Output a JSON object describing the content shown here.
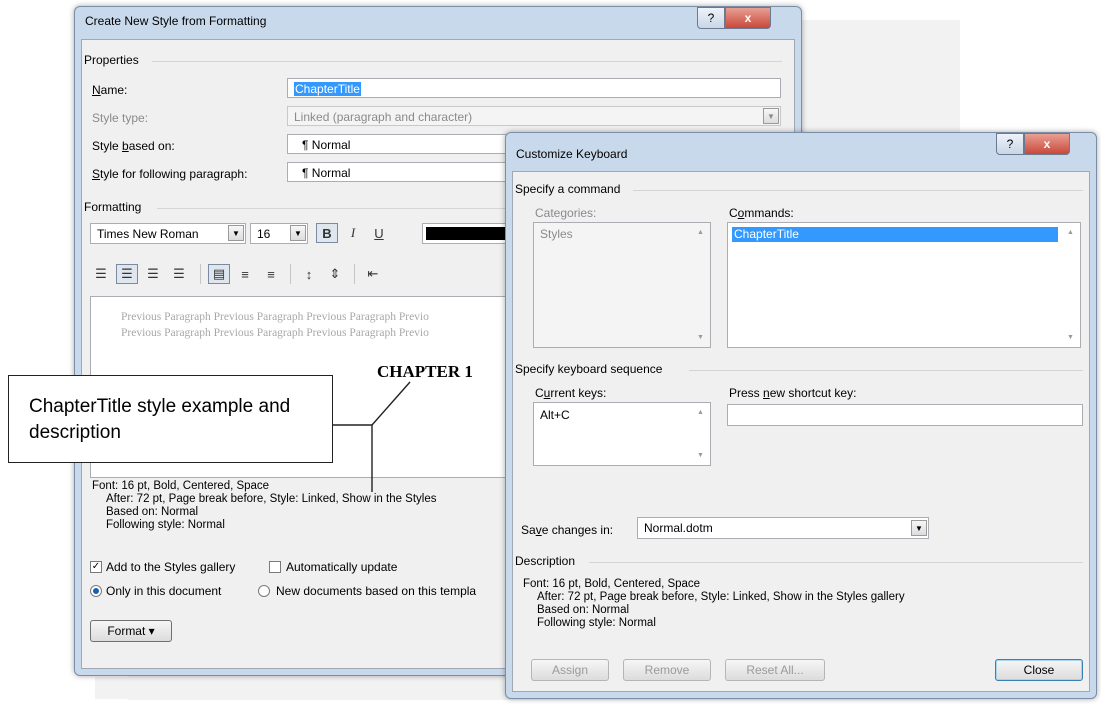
{
  "create_dialog": {
    "title": "Create New Style from Formatting",
    "help_btn": "?",
    "close_btn": "x",
    "properties_heading": "Properties",
    "name_label": "Name:",
    "name_value": "ChapterTitle",
    "style_type_label": "Style type:",
    "style_type_value": "Linked (paragraph and character)",
    "based_on_label": "Style based on:",
    "based_on_value": "¶  Normal",
    "following_label": "Style for following paragraph:",
    "following_value": "¶  Normal",
    "formatting_heading": "Formatting",
    "font_name": "Times New Roman",
    "font_size": "16",
    "bold": "B",
    "italic": "I",
    "underline": "U",
    "prev_para_1": "Previous Paragraph Previous Paragraph Previous Paragraph Previo",
    "prev_para_2": "Previous Paragraph Previous Paragraph Previous Paragraph Previo",
    "sample_text": "CHAPTER 1",
    "desc_line1": "Font: 16 pt, Bold, Centered, Space",
    "desc_line2": "After:  72 pt, Page break before, Style: Linked, Show in the Styles",
    "desc_line3": "Based on: Normal",
    "desc_line4": "Following style: Normal",
    "add_gallery": "Add to the Styles gallery",
    "auto_update": "Automatically update",
    "only_doc": "Only in this document",
    "new_docs": "New documents based on this templa",
    "format_btn": "Format ▾"
  },
  "keyboard_dialog": {
    "title": "Customize Keyboard",
    "help_btn": "?",
    "close_btn": "x",
    "specify_command": "Specify a command",
    "categories_label": "Categories:",
    "categories": [
      "Styles"
    ],
    "commands_label": "Commands:",
    "commands": [
      "ChapterTitle"
    ],
    "specify_sequence": "Specify keyboard sequence",
    "current_keys_label": "Current keys:",
    "current_keys": [
      "Alt+C"
    ],
    "press_new_label": "Press new shortcut key:",
    "press_new_value": "",
    "save_in_label": "Save changes in:",
    "save_in_value": "Normal.dotm",
    "description_heading": "Description",
    "desc_line1": "Font: 16 pt, Bold, Centered, Space",
    "desc_line2": "After:  72 pt, Page break before, Style: Linked, Show in the Styles gallery",
    "desc_line3": "Based on: Normal",
    "desc_line4": "Following style: Normal",
    "assign_btn": "Assign",
    "remove_btn": "Remove",
    "reset_btn": "Reset All...",
    "close_button": "Close"
  },
  "callout": {
    "text": "ChapterTitle style example and description"
  }
}
